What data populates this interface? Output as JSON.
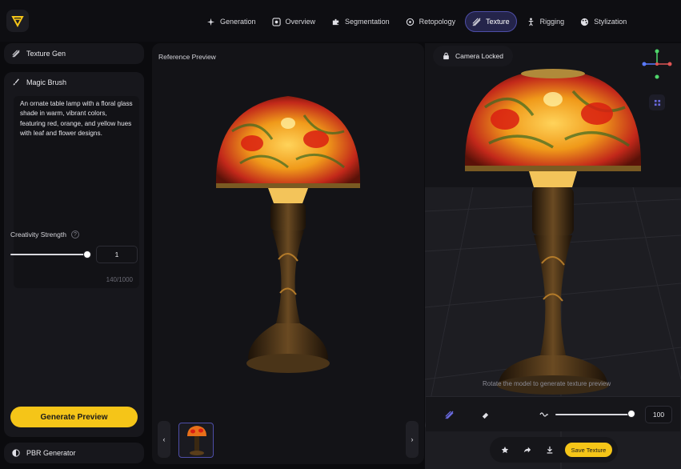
{
  "nav": {
    "items": [
      {
        "label": "Generation",
        "icon": "sparkle-icon",
        "active": false
      },
      {
        "label": "Overview",
        "icon": "focus-icon",
        "active": false
      },
      {
        "label": "Segmentation",
        "icon": "puzzle-icon",
        "active": false
      },
      {
        "label": "Retopology",
        "icon": "mesh-icon",
        "active": false
      },
      {
        "label": "Texture",
        "icon": "stripes-icon",
        "active": true
      },
      {
        "label": "Rigging",
        "icon": "figure-icon",
        "active": false
      },
      {
        "label": "Stylization",
        "icon": "palette-icon",
        "active": false
      }
    ]
  },
  "left": {
    "texture_gen_label": "Texture Gen",
    "magic_brush_label": "Magic Brush",
    "prompt_text": "An ornate table lamp with a floral glass shade in warm, vibrant colors, featuring red, orange, and yellow hues with leaf and flower designs.",
    "prompt_count": "140/1000",
    "creativity_label": "Creativity Strength",
    "creativity_help": "?",
    "creativity_level": 1.0,
    "creativity_value": "1",
    "generate_label": "Generate Preview",
    "pbr_label": "PBR Generator"
  },
  "reference": {
    "title": "Reference Preview",
    "prev": "‹",
    "next": "›"
  },
  "viewport": {
    "camera_label": "Camera Locked",
    "hint": "Rotate the model to generate texture preview",
    "brush_size_value": "100",
    "brush_size_level": 1.0,
    "save_label": "Save Texture"
  },
  "colors": {
    "accent": "#f5c518",
    "nav_active_bg": "#24244a",
    "nav_active_border": "#4e4ea8"
  }
}
